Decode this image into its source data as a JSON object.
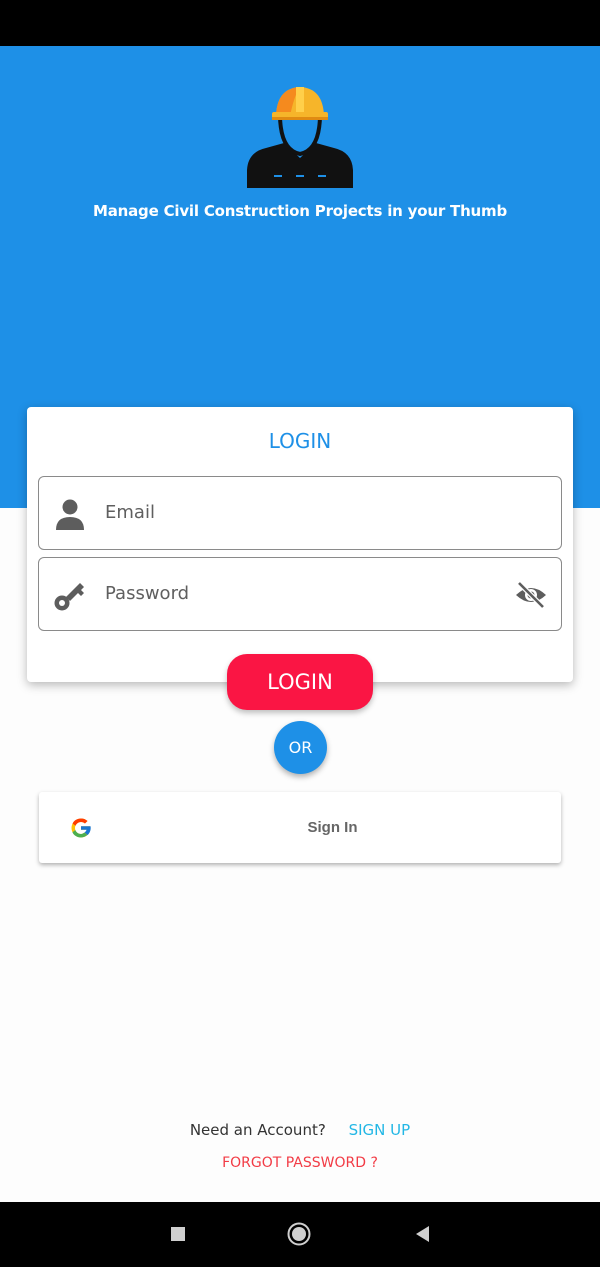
{
  "header": {
    "tagline": "Manage Civil Construction Projects in your Thumb",
    "logo_icon": "construction-worker-icon",
    "brand_color": "#1e90e7"
  },
  "login_card": {
    "title": "LOGIN",
    "email": {
      "placeholder": "Email",
      "value": "",
      "icon": "person-icon"
    },
    "password": {
      "placeholder": "Password",
      "value": "",
      "icon": "key-icon",
      "toggle_icon": "eye-off-icon"
    }
  },
  "login_button": {
    "label": "LOGIN",
    "color": "#fa1544"
  },
  "divider": {
    "label": "OR"
  },
  "google_button": {
    "label": "Sign In",
    "icon": "google-g-icon"
  },
  "footer": {
    "need_account": "Need an Account?",
    "sign_up": "SIGN UP",
    "forgot_password": "FORGOT PASSWORD ?"
  },
  "nav": {
    "buttons": [
      "recents-icon",
      "home-icon",
      "back-icon"
    ]
  }
}
